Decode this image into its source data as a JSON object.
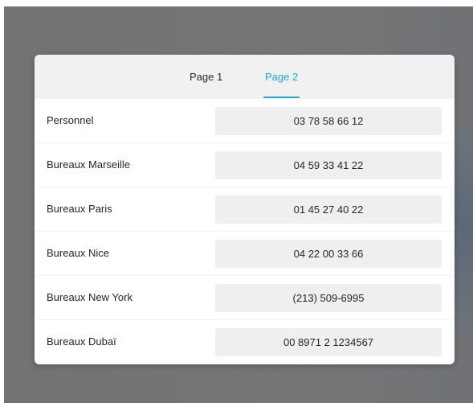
{
  "tabs": [
    {
      "label": "Page 1",
      "active": false
    },
    {
      "label": "Page 2",
      "active": true
    }
  ],
  "colors": {
    "accent": "#1ea6d6",
    "backdrop": "#757575",
    "tabbar": "#f1f1f1",
    "value_bg": "#efefef"
  },
  "rows": [
    {
      "label": "Personnel",
      "value": "03 78 58 66 12"
    },
    {
      "label": "Bureaux Marseille",
      "value": "04 59 33 41 22"
    },
    {
      "label": "Bureaux Paris",
      "value": "01 45 27 40 22"
    },
    {
      "label": "Bureaux Nice",
      "value": "04 22 00 33 66"
    },
    {
      "label": "Bureaux New York",
      "value": "(213) 509-6995"
    },
    {
      "label": "Bureaux Dubaï",
      "value": "00 8971 2 1234567"
    }
  ]
}
